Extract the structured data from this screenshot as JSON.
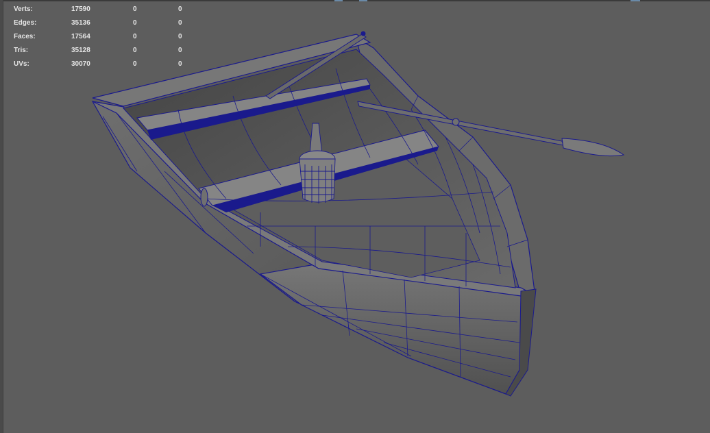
{
  "viewport": {
    "background": "#5d5d5d",
    "wire_color": "#1a1a8c",
    "shaded_color": "#6e6e6e"
  },
  "hud": {
    "rows": [
      {
        "label": "Verts:",
        "total": "17590",
        "selected": "0",
        "component": "0"
      },
      {
        "label": "Edges:",
        "total": "35136",
        "selected": "0",
        "component": "0"
      },
      {
        "label": "Faces:",
        "total": "17564",
        "selected": "0",
        "component": "0"
      },
      {
        "label": "Tris:",
        "total": "35128",
        "selected": "0",
        "component": "0"
      },
      {
        "label": "UVs:",
        "total": "30070",
        "selected": "0",
        "component": "0"
      }
    ]
  },
  "scene": {
    "object": "rowboat-wireframe-on-shaded"
  }
}
